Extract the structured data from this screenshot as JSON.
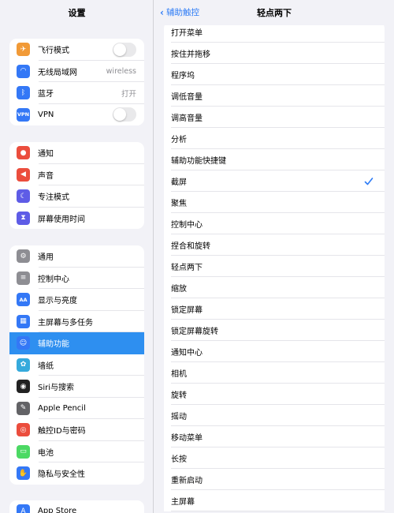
{
  "sidebar": {
    "title": "设置",
    "group1": [
      {
        "label": "飞行模式",
        "icon": "airplane-icon",
        "color": "#f19a37",
        "control": "toggle"
      },
      {
        "label": "无线局域网",
        "icon": "wifi-icon",
        "color": "#3478f6",
        "value": "wireless"
      },
      {
        "label": "蓝牙",
        "icon": "bluetooth-icon",
        "color": "#3478f6",
        "value": "打开"
      },
      {
        "label": "VPN",
        "icon": "vpn-icon",
        "color": "#3478f6",
        "icon_text": "VPN",
        "control": "toggle"
      }
    ],
    "group2": [
      {
        "label": "通知",
        "icon": "notification-icon",
        "color": "#eb4d3d"
      },
      {
        "label": "声音",
        "icon": "sound-icon",
        "color": "#eb4d3d"
      },
      {
        "label": "专注模式",
        "icon": "moon-icon",
        "color": "#5e5ce6"
      },
      {
        "label": "屏幕使用时间",
        "icon": "hourglass-icon",
        "color": "#5e5ce6"
      }
    ],
    "group3": [
      {
        "label": "通用",
        "icon": "gear-icon",
        "color": "#8e8e93"
      },
      {
        "label": "控制中心",
        "icon": "switches-icon",
        "color": "#8e8e93"
      },
      {
        "label": "显示与亮度",
        "icon": "display-icon",
        "color": "#3478f6",
        "icon_text": "AA"
      },
      {
        "label": "主屏幕与多任务",
        "icon": "home-grid-icon",
        "color": "#3478f6"
      },
      {
        "label": "辅助功能",
        "icon": "accessibility-icon",
        "color": "#3478f6",
        "selected": true
      },
      {
        "label": "墙纸",
        "icon": "wallpaper-icon",
        "color": "#35aadc"
      },
      {
        "label": "Siri与搜索",
        "icon": "siri-icon",
        "color": "#222222"
      },
      {
        "label": "Apple Pencil",
        "icon": "pencil-icon",
        "color": "#636366"
      },
      {
        "label": "触控ID与密码",
        "icon": "fingerprint-icon",
        "color": "#eb4d3d"
      },
      {
        "label": "电池",
        "icon": "battery-icon",
        "color": "#4cd964"
      },
      {
        "label": "隐私与安全性",
        "icon": "hand-icon",
        "color": "#3478f6"
      }
    ],
    "group4": [
      {
        "label": "App Store",
        "icon": "app-store-icon",
        "color": "#3478f6"
      }
    ]
  },
  "detail": {
    "back_label": "辅助触控",
    "title": "轻点两下",
    "accent": "#2e7cf6",
    "items": [
      {
        "label": "打开菜单"
      },
      {
        "label": "按住并拖移"
      },
      {
        "label": "程序坞"
      },
      {
        "label": "调低音量"
      },
      {
        "label": "调高音量"
      },
      {
        "label": "分析"
      },
      {
        "label": "辅助功能快捷键"
      },
      {
        "label": "截屏",
        "checked": true
      },
      {
        "label": "聚焦"
      },
      {
        "label": "控制中心"
      },
      {
        "label": "捏合和旋转"
      },
      {
        "label": "轻点两下"
      },
      {
        "label": "缩放"
      },
      {
        "label": "锁定屏幕"
      },
      {
        "label": "锁定屏幕旋转"
      },
      {
        "label": "通知中心"
      },
      {
        "label": "相机"
      },
      {
        "label": "旋转"
      },
      {
        "label": "摇动"
      },
      {
        "label": "移动菜单"
      },
      {
        "label": "长按"
      },
      {
        "label": "重新启动"
      },
      {
        "label": "主屏幕"
      }
    ]
  }
}
